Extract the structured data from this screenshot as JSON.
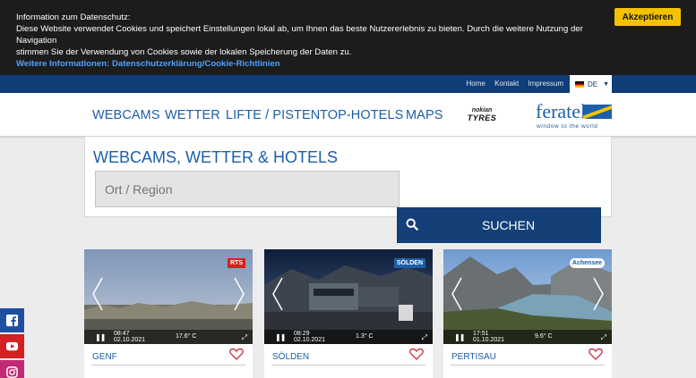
{
  "cookie": {
    "title": "Information zum Datenschutz:",
    "line1": "Diese Website verwendet Cookies und speichert Einstellungen lokal ab, um Ihnen das beste Nutzererlebnis zu bieten. Durch die weitere Nutzung der Navigation",
    "line2": "stimmen Sie der Verwendung von Cookies sowie der lokalen Speicherung der Daten zu.",
    "link": "Weitere Informationen: Datenschutzerklärung/Cookie-Richtlinien",
    "accept": "Akzeptieren"
  },
  "topbar": {
    "links": [
      "Home",
      "Kontakt",
      "Impressum"
    ],
    "language": "DE"
  },
  "nav": {
    "items": [
      "WEBCAMS",
      "WETTER",
      "LIFTE / PISTEN",
      "TOP-HOTELS",
      "MAPS"
    ],
    "sponsor_line1": "nokian",
    "sponsor_line2": "TYRES",
    "brand": "feratel",
    "brand_tagline": "window to the world"
  },
  "search": {
    "title": "WEBCAMS, WETTER & HOTELS",
    "placeholder": "Ort / Region",
    "button": "SUCHEN"
  },
  "cards": [
    {
      "name": "GENF",
      "time": "08:47",
      "date": "02.10.2021",
      "temp": "17.6° C",
      "badge": "RTS"
    },
    {
      "name": "SÖLDEN",
      "time": "08:29",
      "date": "02.10.2021",
      "temp": "1.3° C",
      "badge": "SÖLDEN"
    },
    {
      "name": "PERTISAU",
      "time": "17:51",
      "date": "01.10.2021",
      "temp": "9.6° C",
      "badge": "Achensee"
    }
  ],
  "colors": {
    "brand_blue": "#1d5ea8",
    "dark_blue": "#143f77",
    "accent_yellow": "#f5c200",
    "facebook": "#1f4fa0",
    "youtube": "#d42020",
    "instagram": "#c22b73"
  }
}
